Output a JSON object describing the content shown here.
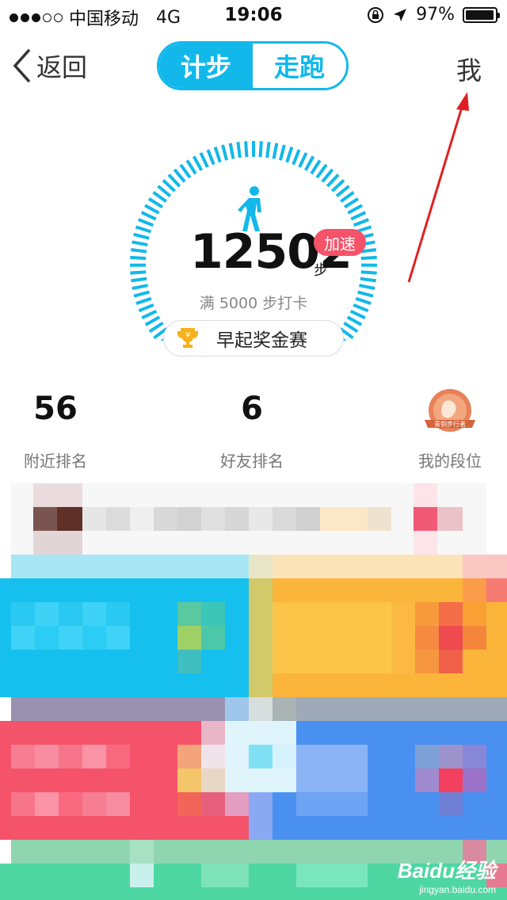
{
  "status_bar": {
    "carrier": "中国移动",
    "network": "4G",
    "time": "19:06",
    "battery_text": "97%",
    "battery_level": 0.97,
    "signal_bars": 3,
    "signal_total": 5
  },
  "nav": {
    "back_label": "返回",
    "tabs": [
      {
        "label": "计步",
        "active": true
      },
      {
        "label": "走跑",
        "active": false
      }
    ],
    "me_label": "我"
  },
  "pedometer": {
    "steps": "12502",
    "steps_unit": "步",
    "boost_label": "加速",
    "goal_text": "满 5000 步打卡",
    "contest_label": "早起奖金赛",
    "trophy_char": "¥"
  },
  "rankings": [
    {
      "value": "56",
      "caption": "附近排名"
    },
    {
      "value": "6",
      "caption": "好友排名"
    },
    {
      "value": "",
      "caption": "我的段位",
      "badge_text": "青铜步行者"
    }
  ],
  "watermark": {
    "brand": "Baidu经验",
    "url": "jingyan.baidu.com"
  },
  "colors": {
    "accent": "#12b8ea",
    "boost": "#f4536a",
    "annotation_arrow": "#e02020",
    "tile_blue": "#15c0ee",
    "tile_orange": "#fbb53b",
    "tile_red": "#f4536a",
    "tile_indigo": "#4a90f0",
    "tile_green": "#4fd7a3"
  }
}
